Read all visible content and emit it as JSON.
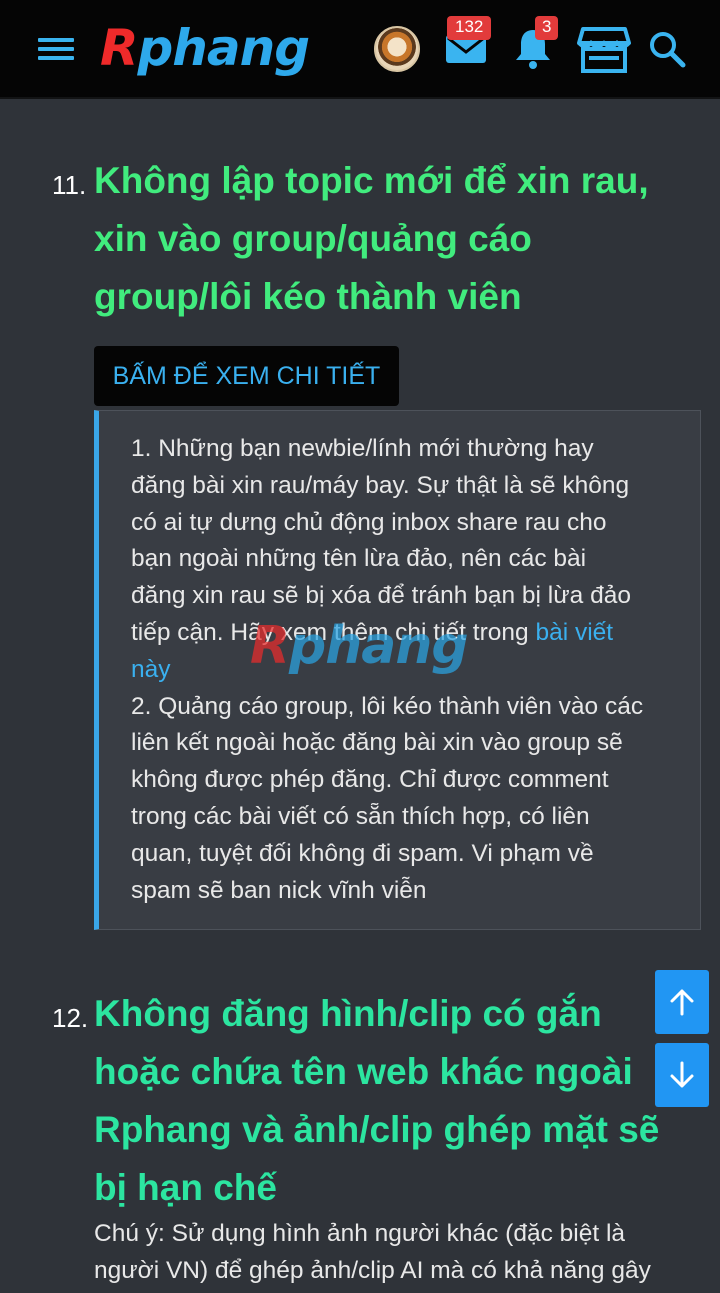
{
  "header": {
    "logo_first_letter": "R",
    "logo_rest": "phang",
    "mail_badge": "132",
    "notification_badge": "3"
  },
  "rule11": {
    "number": "11.",
    "title_lines": [
      "Không lập topic mới để xin rau,",
      "xin vào group/quảng cáo",
      "group/lôi kéo thành viên"
    ],
    "spoiler_button": "BẤM ĐỂ XEM CHI TIẾT",
    "spoiler_lines": [
      "1. Những bạn newbie/lính mới thường hay",
      "đăng bài xin rau/máy bay. Sự thật là sẽ không",
      "có ai tự dưng chủ động inbox share rau cho",
      "bạn ngoài những tên lừa đảo, nên các bài",
      "đăng xin rau sẽ bị xóa để tránh bạn bị lừa đảo",
      "tiếp cận. Hãy xem thêm chi tiết trong ",
      "2. Quảng cáo group, lôi kéo thành viên vào các",
      "liên kết ngoài hoặc đăng bài xin vào group sẽ",
      "không được phép đăng. Chỉ được comment",
      "trong các bài viết có sẵn thích hợp, có liên",
      "quan, tuyệt đối không đi spam. Vi phạm về",
      "spam sẽ ban nick vĩnh viễn"
    ],
    "link_part1": "bài viết",
    "link_part2": "này"
  },
  "rule12": {
    "number": "12.",
    "title_lines": [
      "Không đăng hình/clip có gắn",
      "hoặc chứa tên web khác ngoài",
      "Rphang và ảnh/clip ghép mặt sẽ",
      "bị hạn chế"
    ],
    "note_lines": [
      "Chú ý: Sử dụng hình ảnh người khác (đặc biệt là",
      "người VN) để ghép ảnh/clip AI mà có khả năng gây"
    ]
  },
  "icons": {
    "menu": "menu-icon",
    "mail": "mail-icon",
    "bell": "bell-icon",
    "store": "store-icon",
    "search": "search-icon",
    "scroll_up": "arrow-up-icon",
    "scroll_down": "arrow-down-icon"
  },
  "colors": {
    "accent_blue": "#3ab0ef",
    "title_green": "#41ec7e",
    "title_teal": "#2ce5a0",
    "logo_red": "#ef2a2a",
    "badge_red": "#e23b3b",
    "background": "#2f3339"
  }
}
